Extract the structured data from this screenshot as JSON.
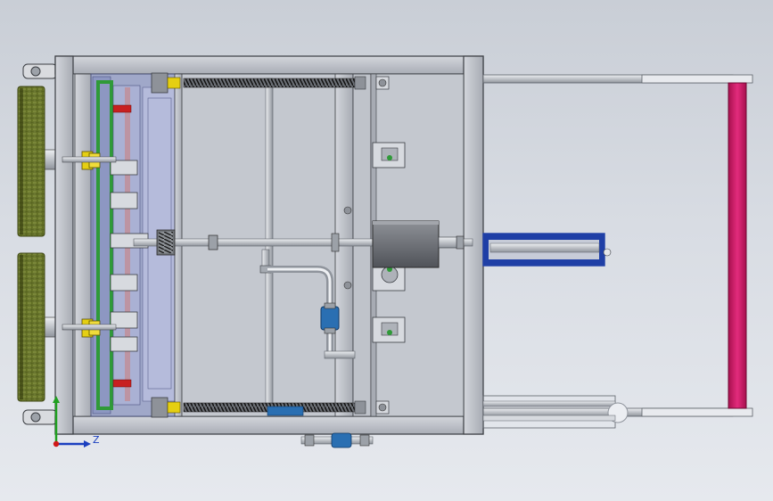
{
  "view": {
    "background_top": "#c9ced6",
    "background_bottom": "#e6e9ee"
  },
  "triad": {
    "axis_z_label": "Z",
    "color_y": "#20a020",
    "color_z": "#1b3fbf",
    "color_origin": "#d01818"
  },
  "colors": {
    "frame": "#b9bdc4",
    "frame_edge": "#3a3d42",
    "guard_panel": "#9aa3c9",
    "green_rail": "#2f9a38",
    "spring": "#2a2a2a",
    "wheel_tread": "#7d8a3a",
    "collar_yellow": "#e5cf12",
    "motor_body": "#7d8086",
    "cylinder_blue": "#1f3fa6",
    "handle_bar": "#cf1766",
    "valve_blue": "#2a6fb2"
  },
  "icons": [
    "coordinate-triad-icon"
  ]
}
